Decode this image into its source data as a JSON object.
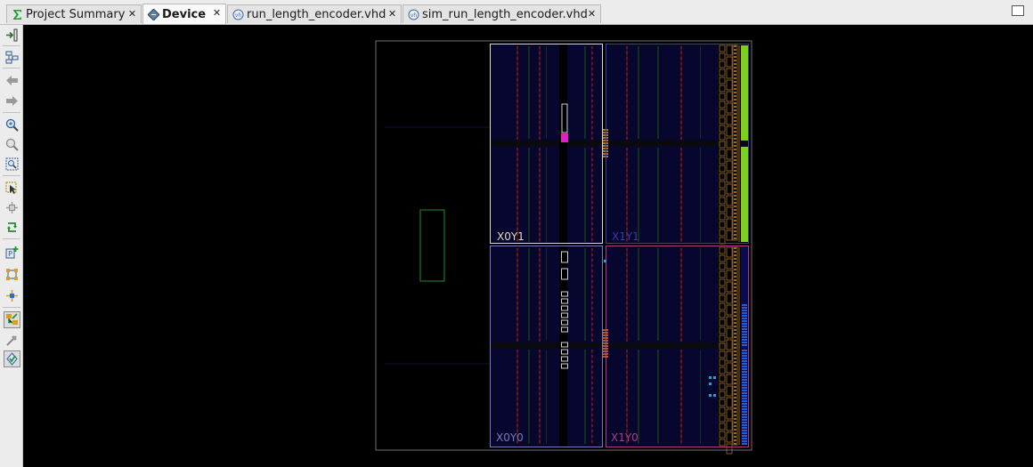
{
  "tabs": [
    {
      "label": "Project Summary",
      "icon": "sigma-icon",
      "active": false
    },
    {
      "label": "Device",
      "icon": "chip-icon",
      "active": true
    },
    {
      "label": "run_length_encoder.vhd",
      "icon": "vhdl-file-icon",
      "active": false
    },
    {
      "label": "sim_run_length_encoder.vhd",
      "icon": "vhdl-file-icon",
      "active": false
    }
  ],
  "toolbar": [
    "auto-fit-selection-icon",
    "fit-selection-icon",
    "back-icon",
    "forward-icon",
    "zoom-in-icon",
    "zoom-out-icon",
    "zoom-fit-icon",
    "select-icon",
    "route-icon",
    "refresh-icon",
    "add-pblock-icon",
    "show-nets-icon",
    "auto-place-icon",
    "toggle-routing-icon",
    "mark-icon",
    "show-io-icon"
  ],
  "device": {
    "clock_regions": [
      {
        "label": "X0Y1",
        "color": "#dcdcbc"
      },
      {
        "label": "X1Y1",
        "color": "#3a3aa8"
      },
      {
        "label": "X0Y0",
        "color": "#7a7ab8"
      },
      {
        "label": "X1Y0",
        "color": "#b03a88"
      }
    ],
    "colors": {
      "fabric": "#06062e",
      "border": "#7a7a7a",
      "highlight": "#e020c0",
      "io_green": "#7cd020",
      "io_blue": "#1f5fd8"
    }
  }
}
